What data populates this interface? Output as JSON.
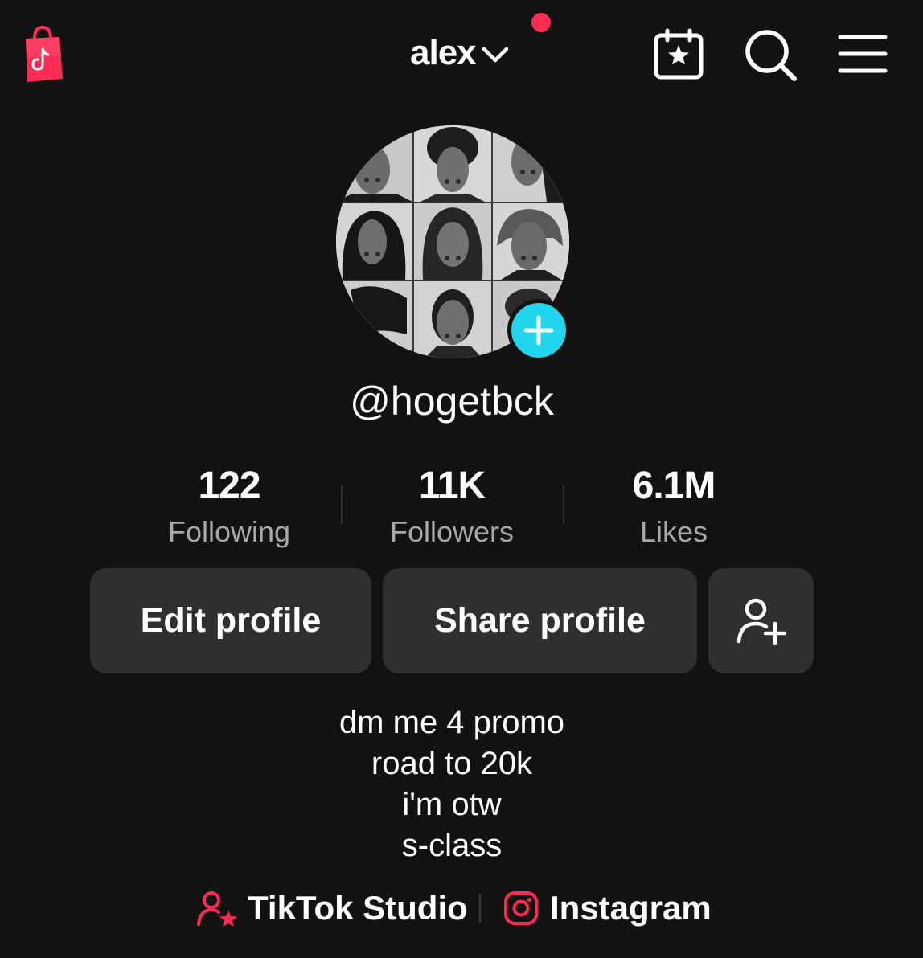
{
  "header": {
    "account_name": "alex",
    "has_notification": true
  },
  "profile": {
    "username": "@hogetbck"
  },
  "stats": [
    {
      "value": "122",
      "label": "Following"
    },
    {
      "value": "11K",
      "label": "Followers"
    },
    {
      "value": "6.1M",
      "label": "Likes"
    }
  ],
  "actions": {
    "edit_label": "Edit profile",
    "share_label": "Share profile"
  },
  "bio": [
    "dm me 4 promo",
    "road to 20k",
    "i'm otw",
    "s-class"
  ],
  "links": {
    "studio_label": "TikTok Studio",
    "instagram_label": "Instagram"
  },
  "icons": {
    "shop": "shopping-bag-icon",
    "chevron": "chevron-down-icon",
    "calendar": "calendar-star-icon",
    "search": "search-icon",
    "menu": "hamburger-menu-icon",
    "add_avatar": "plus-icon",
    "add_friend": "add-user-icon",
    "studio": "user-star-icon",
    "instagram": "instagram-icon"
  },
  "colors": {
    "background": "#121212",
    "button_bg": "#2f2f2f",
    "accent_red": "#fe2c55",
    "accent_cyan": "#20d5ec",
    "muted_text": "#a8a8a8"
  }
}
